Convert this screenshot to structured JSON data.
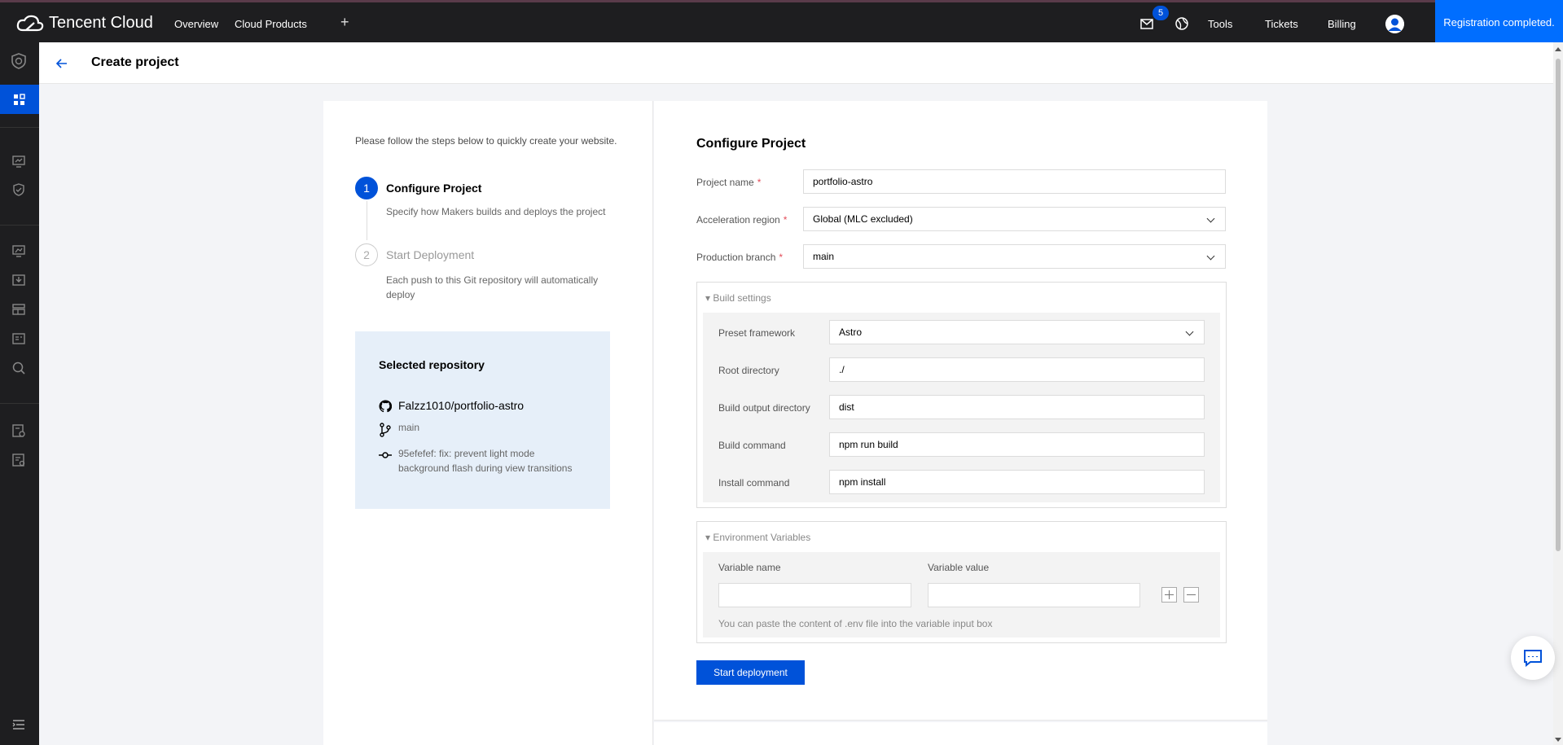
{
  "topnav": {
    "brand": "Tencent Cloud",
    "links": [
      "Overview",
      "Cloud Products"
    ],
    "add_icon": "+",
    "mail_badge": "5",
    "right_links": [
      "Tools",
      "Tickets",
      "Billing"
    ],
    "registration": "Registration completed."
  },
  "header": {
    "title": "Create project"
  },
  "steps": {
    "intro": "Please follow the steps below to quickly create your website.",
    "items": [
      {
        "number": "1",
        "title": "Configure Project",
        "desc": "Specify how Makers builds and deploys the project"
      },
      {
        "number": "2",
        "title": "Start Deployment",
        "desc": "Each push to this Git repository will automatically deploy"
      }
    ]
  },
  "repo": {
    "title": "Selected repository",
    "name": "Falzz1010/portfolio-astro",
    "branch": "main",
    "commit": "95efefef: fix: prevent light mode background flash during view transitions"
  },
  "form": {
    "title": "Configure Project",
    "project_name_label": "Project name",
    "project_name_value": "portfolio-astro",
    "region_label": "Acceleration region",
    "region_value": "Global (MLC excluded)",
    "branch_label": "Production branch",
    "branch_value": "main",
    "required_mark": "*"
  },
  "build": {
    "title": "Build settings",
    "rows": [
      {
        "label": "Preset framework",
        "value": "Astro"
      },
      {
        "label": "Root directory",
        "value": "./"
      },
      {
        "label": "Build output directory",
        "value": "dist"
      },
      {
        "label": "Build command",
        "value": "npm run build"
      },
      {
        "label": "Install command",
        "value": "npm install"
      }
    ]
  },
  "env": {
    "title": "Environment Variables",
    "name_label": "Variable name",
    "value_label": "Variable value",
    "hint": "You can paste the content of .env file into the variable input box"
  },
  "actions": {
    "start": "Start deployment"
  },
  "colors": {
    "primary": "#0052d9",
    "nav_bg": "#1e1e20",
    "registration_bg": "#006eff",
    "repo_bg": "#e6eff9"
  }
}
